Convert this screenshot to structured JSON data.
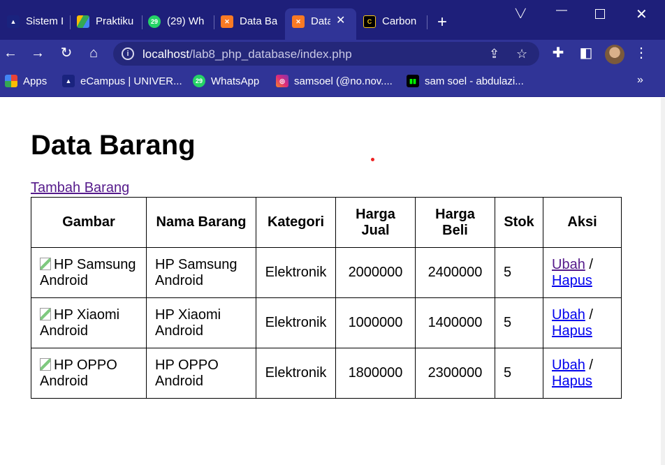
{
  "browser": {
    "tabs": [
      {
        "title": "Sistem I",
        "icon": "ecampus-icon",
        "color": "#1a237e"
      },
      {
        "title": "Praktiku",
        "icon": "drive-icon",
        "color": "#34a853"
      },
      {
        "title": "(29) Wh",
        "icon": "whatsapp-icon",
        "color": "#25d366",
        "badge": "29"
      },
      {
        "title": "Data Ba",
        "icon": "xampp-icon",
        "color": "#fb7a24"
      },
      {
        "title": "Data",
        "icon": "xampp-icon",
        "color": "#fb7a24",
        "active": true
      },
      {
        "title": "Carbon",
        "icon": "carbon-icon",
        "color": "#000000"
      }
    ],
    "new_tab": "+",
    "url": {
      "host": "localhost",
      "path": "/lab8_php_database/index.php"
    },
    "bookmarks": [
      {
        "label": "Apps",
        "icon": "apps-grid-icon"
      },
      {
        "label": "eCampus | UNIVER...",
        "icon": "ecampus-icon"
      },
      {
        "label": "WhatsApp",
        "icon": "whatsapp-icon",
        "badge": "29"
      },
      {
        "label": "samsoel (@no.nov....",
        "icon": "instagram-icon"
      },
      {
        "label": "sam soel - abdulazi...",
        "icon": "medium-icon"
      }
    ],
    "bookmarks_more": "»"
  },
  "page": {
    "title": "Data Barang",
    "add_link": "Tambah Barang",
    "table": {
      "headers": [
        "Gambar",
        "Nama Barang",
        "Kategori",
        "Harga Jual",
        "Harga Beli",
        "Stok",
        "Aksi"
      ],
      "rows": [
        {
          "gambar_alt": "HP Samsung Android",
          "nama": "HP Samsung Android",
          "kategori": "Elektronik",
          "harga_jual": "2000000",
          "harga_beli": "2400000",
          "stok": "5",
          "ubah": "Ubah",
          "sep": "/",
          "hapus": "Hapus"
        },
        {
          "gambar_alt": "HP Xiaomi Android",
          "nama": "HP Xiaomi Android",
          "kategori": "Elektronik",
          "harga_jual": "1000000",
          "harga_beli": "1400000",
          "stok": "5",
          "ubah": "Ubah",
          "sep": "/",
          "hapus": "Hapus"
        },
        {
          "gambar_alt": "HP OPPO Android",
          "nama": "HP OPPO Android",
          "kategori": "Elektronik",
          "harga_jual": "1800000",
          "harga_beli": "2300000",
          "stok": "5",
          "ubah": "Ubah",
          "sep": "/",
          "hapus": "Hapus"
        }
      ]
    }
  },
  "colors": {
    "chrome": "#303497",
    "tabstrip": "#1e1f7a",
    "link": "#0000ee",
    "visited_link": "#551a8b"
  }
}
